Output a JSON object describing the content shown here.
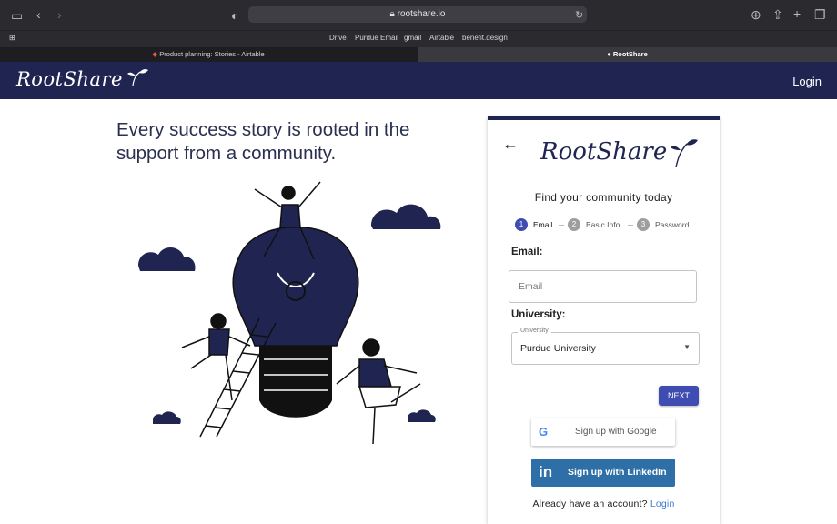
{
  "browser": {
    "url": "rootshare.io",
    "favorites": [
      "Drive",
      "Purdue Email",
      "gmail",
      "Airtable",
      "benefit.design"
    ],
    "tabs": [
      {
        "label": "Product planning: Stories - Airtable",
        "active": false
      },
      {
        "label": "RootShare",
        "active": true
      }
    ]
  },
  "nav": {
    "brand": "RootShare",
    "login": "Login"
  },
  "hero": {
    "headline": "Every success story is rooted in the support from a community."
  },
  "signup": {
    "logo": "RootShare",
    "title": "Find your community today",
    "steps": [
      {
        "num": "1",
        "label": "Email",
        "active": true
      },
      {
        "num": "2",
        "label": "Basic Info",
        "active": false
      },
      {
        "num": "3",
        "label": "Password",
        "active": false
      }
    ],
    "email_label": "Email:",
    "email_placeholder": "Email",
    "university_label": "University:",
    "university_legend": "University",
    "university_value": "Purdue University",
    "next": "NEXT",
    "google": "Sign up with Google",
    "linkedin": "Sign up with LinkedIn",
    "already": "Already have an account?",
    "login_link": "Login"
  },
  "colors": {
    "navy": "#1f2550",
    "accent": "#3f4cb1",
    "linkedin": "#2d6fa6"
  }
}
